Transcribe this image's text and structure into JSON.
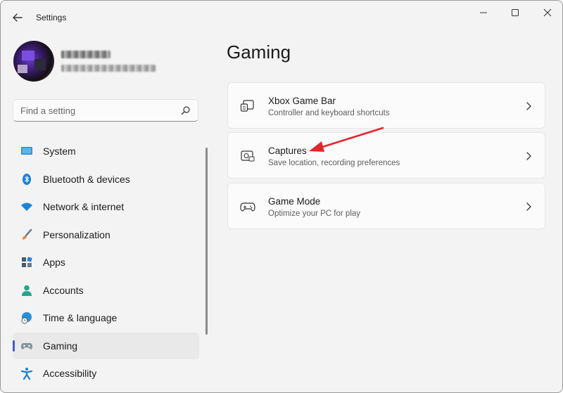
{
  "window": {
    "title": "Settings"
  },
  "profile": {
    "name_blurred": true,
    "email_blurred": true
  },
  "search": {
    "placeholder": "Find a setting",
    "value": ""
  },
  "nav": {
    "items": [
      {
        "label": "System",
        "icon": "monitor-icon",
        "active": false
      },
      {
        "label": "Bluetooth & devices",
        "icon": "bluetooth-icon",
        "active": false
      },
      {
        "label": "Network & internet",
        "icon": "wifi-icon",
        "active": false
      },
      {
        "label": "Personalization",
        "icon": "paintbrush-icon",
        "active": false
      },
      {
        "label": "Apps",
        "icon": "apps-icon",
        "active": false
      },
      {
        "label": "Accounts",
        "icon": "person-icon",
        "active": false
      },
      {
        "label": "Time & language",
        "icon": "globe-clock-icon",
        "active": false
      },
      {
        "label": "Gaming",
        "icon": "controller-icon",
        "active": true
      },
      {
        "label": "Accessibility",
        "icon": "accessibility-icon",
        "active": false
      }
    ]
  },
  "main": {
    "title": "Gaming",
    "cards": [
      {
        "title": "Xbox Game Bar",
        "subtitle": "Controller and keyboard shortcuts",
        "icon": "game-bar-icon"
      },
      {
        "title": "Captures",
        "subtitle": "Save location, recording preferences",
        "icon": "capture-icon"
      },
      {
        "title": "Game Mode",
        "subtitle": "Optimize your PC for play",
        "icon": "gamepad-icon"
      }
    ]
  },
  "colors": {
    "accent": "#3b5bd6",
    "annotation": "#e3262c",
    "background": "#f3f3f3"
  }
}
